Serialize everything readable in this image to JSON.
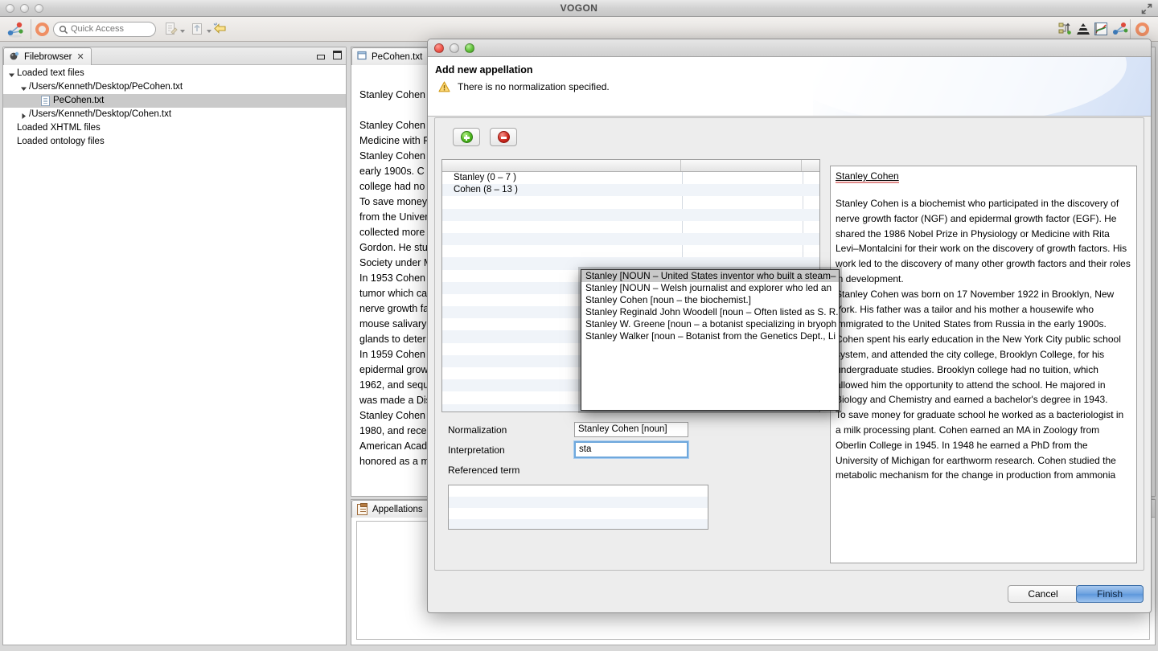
{
  "window": {
    "title": "VOGON",
    "expand_icon": "expand-icon"
  },
  "toolbar": {
    "quick_access_placeholder": "Quick Access",
    "search_icon": "search-icon",
    "perspective_icon": "perspective-icon",
    "icons": [
      "new-wizard-icon",
      "open-type-icon",
      "back-arrow-icon"
    ],
    "right_icons": [
      "hierarchy-icon",
      "pyramid-icon",
      "graph-icon",
      "network-icon",
      "perspective-circle-icon"
    ]
  },
  "filebrowser": {
    "tab_label": "Filebrowser",
    "tab_close_icon": "close-icon",
    "minimize_icon": "minimize-icon",
    "maximize_icon": "maximize-icon",
    "tree": [
      {
        "label": "Loaded text files",
        "indent": 0,
        "twisty": "down",
        "icon": null,
        "selected": false
      },
      {
        "label": "/Users/Kenneth/Desktop/PeCohen.txt",
        "indent": 1,
        "twisty": "down",
        "icon": null,
        "selected": false
      },
      {
        "label": "PeCohen.txt",
        "indent": 2,
        "twisty": "none",
        "icon": "text-file-icon",
        "selected": true
      },
      {
        "label": "/Users/Kenneth/Desktop/Cohen.txt",
        "indent": 1,
        "twisty": "right",
        "icon": null,
        "selected": false
      },
      {
        "label": "Loaded XHTML files",
        "indent": 0,
        "twisty": "none",
        "icon": null,
        "selected": false
      },
      {
        "label": "Loaded ontology files",
        "indent": 0,
        "twisty": "none",
        "icon": null,
        "selected": false
      }
    ]
  },
  "editor": {
    "tab_label": "PeCohen.txt",
    "tab_icon": "text-editor-icon",
    "doc_title": "PeCohen.txt",
    "lines": [
      "Stanley Cohen",
      "",
      "Stanley Cohen i",
      "Medicine with R",
      "Stanley Cohen v",
      "early 1900s.  C",
      "college had no ",
      "To save money ",
      "from the Univer",
      "collected more ",
      "Gordon.  He stu",
      "Society under M",
      "In 1953 Cohen ",
      "tumor which ca",
      "nerve growth fa",
      "mouse salivary ",
      "glands to deter",
      "In 1959 Cohen ",
      "epidermal grow",
      "1962, and sequ",
      "was made a Dis",
      "Stanley Cohen h",
      "1980, and recei",
      "American Acade",
      "honored as a m"
    ],
    "highlight_line_index": 0
  },
  "appellations_view": {
    "tab_label": "Appellations",
    "tab_icon": "clipboard-icon"
  },
  "dialog": {
    "traffic": [
      "close-button",
      "minimize-button",
      "zoom-button"
    ],
    "title": "Add new appellation",
    "message": "There is no normalization specified.",
    "warning_icon": "warning-icon",
    "add_button_icon": "add-icon",
    "remove_button_icon": "remove-icon",
    "table": {
      "columns": [
        "",
        "",
        ""
      ],
      "rows": [
        [
          "Stanley (0 – 7 )",
          "",
          ""
        ],
        [
          "Cohen (8 – 13 )",
          "",
          ""
        ],
        [
          "",
          "",
          ""
        ],
        [
          "",
          "",
          ""
        ],
        [
          "",
          "",
          ""
        ],
        [
          "",
          "",
          ""
        ],
        [
          "",
          "",
          ""
        ],
        [
          "",
          "",
          ""
        ],
        [
          "",
          "",
          ""
        ],
        [
          "",
          "",
          ""
        ],
        [
          "",
          "",
          ""
        ],
        [
          "",
          "",
          ""
        ],
        [
          "",
          "",
          ""
        ],
        [
          "",
          "",
          ""
        ],
        [
          "",
          "",
          ""
        ],
        [
          "",
          "",
          ""
        ],
        [
          "",
          "",
          ""
        ],
        [
          "",
          "",
          ""
        ],
        [
          "",
          "",
          ""
        ],
        [
          "",
          "",
          ""
        ]
      ]
    },
    "form": {
      "normalization_label": "Normalization",
      "normalization_value": "Stanley Cohen [noun]",
      "interpretation_label": "Interpretation",
      "interpretation_value": "sta",
      "referenced_term_label": "Referenced term",
      "referenced_term_values": [
        "",
        "",
        "",
        ""
      ]
    },
    "autocomplete": {
      "items": [
        "Stanley [NOUN – United States inventor who built a steam–",
        "Stanley [NOUN – Welsh journalist and explorer who led an ",
        "Stanley Cohen [noun – the biochemist.]",
        "Stanley Reginald John Woodell [noun – Often listed as S. R.",
        "Stanley W. Greene [noun – a botanist specializing in bryoph",
        "Stanley Walker [noun – Botanist from the Genetics Dept., Li"
      ],
      "selected_index": 0
    },
    "preview": {
      "title": "Stanley Cohen",
      "paragraphs": [
        "Stanley Cohen is a biochemist who participated in the discovery of nerve growth factor (NGF) and epidermal growth factor (EGF).  He shared the 1986 Nobel Prize in Physiology or Medicine with Rita Levi–Montalcini for their work on the discovery of growth factors.  His work led to the discovery of many other growth factors and their roles in development.",
        "Stanley Cohen was born on 17 November 1922 in Brooklyn, New York.  His father was a tailor and his mother a housewife who immigrated to the United States from Russia in the early 1900s.",
        "Cohen spent his early education in the New York City public school system, and attended the city college, Brooklyn College, for his undergraduate studies.  Brooklyn college had no tuition, which allowed him the opportunity to attend the school.   He majored in Biology and Chemistry and earned a bachelor's degree in 1943.",
        "To save money for graduate school he worked as a bacteriologist in a milk processing plant.  Cohen earned an MA in Zoology from Oberlin College in 1945.  In 1948 he earned a PhD from the University of Michigan for earthworm research.  Cohen studied the metabolic mechanism for the change in production from ammonia"
      ]
    },
    "buttons": {
      "cancel": "Cancel",
      "finish": "Finish"
    }
  },
  "colors": {
    "accent": "#6fa3e0",
    "selection": "#b8d2ef",
    "tree_selection": "#cacaca",
    "row_alt": "#f0f4f9",
    "warning": "#f0b429"
  }
}
